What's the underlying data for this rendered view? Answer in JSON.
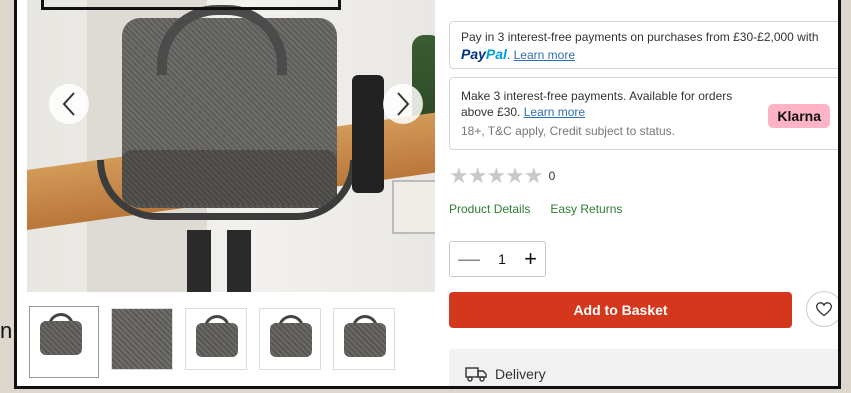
{
  "side_text": "n",
  "gallery": {
    "prev_icon": "chevron-left-icon",
    "next_icon": "chevron-right-icon",
    "thumbnails": [
      {
        "alt": "bag on table"
      },
      {
        "alt": "fabric close-up"
      },
      {
        "alt": "bag with strap"
      },
      {
        "alt": "bag front"
      },
      {
        "alt": "bag open compartment"
      }
    ]
  },
  "paypal": {
    "text": "Pay in 3 interest-free payments on purchases from £30-£2,000 with",
    "logo_a": "Pay",
    "logo_b": "Pal",
    "after_logo": ".",
    "link": "Learn more"
  },
  "klarna": {
    "line1": "Make 3 interest-free payments. Available for orders",
    "line2_prefix": "above £30.",
    "link": "Learn more",
    "sub": "18+, T&C apply, Credit subject to status.",
    "badge": "Klarna"
  },
  "rating": {
    "stars": "★★★★★",
    "count": "0"
  },
  "links": {
    "details": "Product Details",
    "returns": "Easy Returns"
  },
  "quantity": {
    "minus": "—",
    "value": "1",
    "plus": "+"
  },
  "basket_label": "Add to Basket",
  "wishlist_icon": "heart-icon",
  "delivery": {
    "icon": "truck-icon",
    "label": "Delivery"
  },
  "colors": {
    "accent": "#d4371c",
    "link_green": "#2e7d32",
    "klarna_pink": "#ffb3c7"
  }
}
